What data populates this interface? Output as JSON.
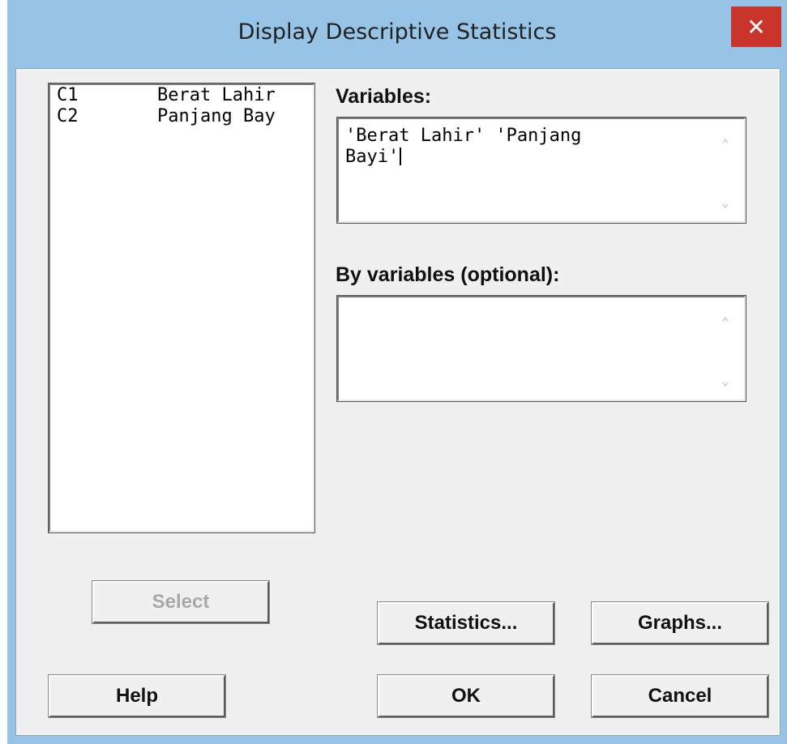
{
  "window": {
    "title": "Display Descriptive Statistics",
    "close_glyph": "✕"
  },
  "columns_list": {
    "items": [
      {
        "id": "C1",
        "name": "Berat Lahir"
      },
      {
        "id": "C2",
        "name": "Panjang Bay"
      }
    ]
  },
  "variables": {
    "label": "Variables:",
    "value": "'Berat Lahir' 'Panjang\nBayi'"
  },
  "by_variables": {
    "label": "By variables (optional):",
    "value": ""
  },
  "buttons": {
    "select": "Select",
    "statistics": "Statistics...",
    "graphs": "Graphs...",
    "help": "Help",
    "ok": "OK",
    "cancel": "Cancel"
  },
  "icons": {
    "scroll_up": "chevron-up-icon",
    "scroll_down": "chevron-down-icon",
    "close": "close-icon"
  },
  "colors": {
    "title_bar": "#96c3e6",
    "close_button": "#c9352b",
    "dialog_bg": "#f0f0f0"
  }
}
